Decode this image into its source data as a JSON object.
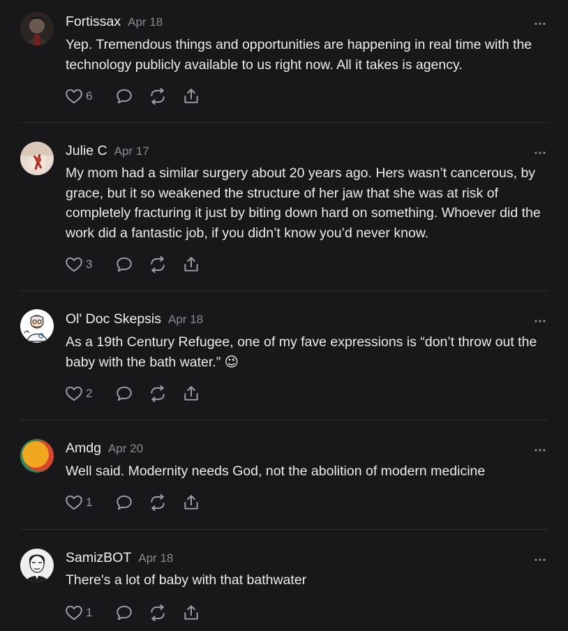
{
  "comments": [
    {
      "author": "Fortissax",
      "date": "Apr 18",
      "text": "Yep. Tremendous things and opportunities are happening in real time with the technology publicly available to us right now. All it takes is agency.",
      "likes": "6"
    },
    {
      "author": "Julie C",
      "date": "Apr 17",
      "text": "My mom had a similar surgery about 20 years ago. Hers wasn’t cancerous, by grace, but it so weakened the structure of her jaw that she was at risk of completely fracturing it just by biting down hard on something. Whoever did the work did a fantastic job, if you didn’t know you’d never know.",
      "likes": "3"
    },
    {
      "author": "Ol' Doc Skepsis",
      "date": "Apr 18",
      "text": "As a 19th Century Refugee, one of my fave expressions is “don’t throw out the baby with the bath water.” 😉",
      "likes": "2"
    },
    {
      "author": "Amdg",
      "date": "Apr 20",
      "text": "Well said. Modernity needs God, not the abolition of modern medicine",
      "likes": "1"
    },
    {
      "author": "SamizBOT",
      "date": "Apr 18",
      "text": "There's a lot of baby with that bathwater",
      "likes": "1"
    }
  ],
  "icons": {
    "like": "heart-icon",
    "reply": "speech-bubble-icon",
    "restack": "restack-icon",
    "share": "share-icon",
    "more": "ellipsis-icon"
  },
  "colors": {
    "background": "#18181a",
    "text": "#ececec",
    "muted": "#8b8b8f",
    "icon": "#a0a0a6",
    "divider": "#2e2e31"
  }
}
